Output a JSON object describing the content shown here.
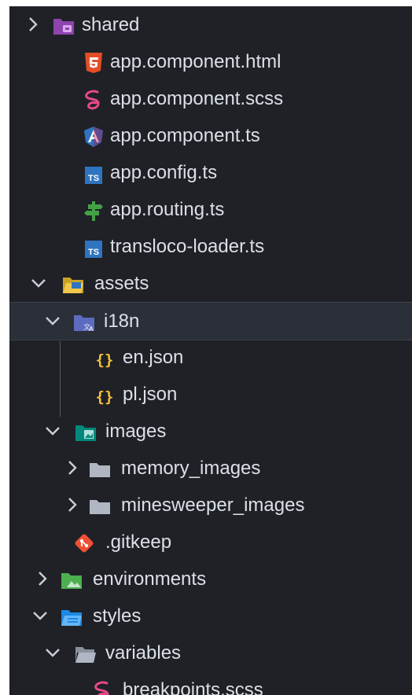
{
  "explorer": {
    "items": [
      {
        "label": "shared",
        "icon": "folder-shared-icon",
        "state": "collapsed"
      },
      {
        "label": "app.component.html",
        "icon": "html-file-icon"
      },
      {
        "label": "app.component.scss",
        "icon": "sass-file-icon"
      },
      {
        "label": "app.component.ts",
        "icon": "angular-component-icon"
      },
      {
        "label": "app.config.ts",
        "icon": "typescript-file-icon"
      },
      {
        "label": "app.routing.ts",
        "icon": "routing-file-icon"
      },
      {
        "label": "transloco-loader.ts",
        "icon": "typescript-file-icon"
      },
      {
        "label": "assets",
        "icon": "folder-assets-icon",
        "state": "expanded"
      },
      {
        "label": "i18n",
        "icon": "folder-i18n-icon",
        "state": "expanded",
        "selected": true
      },
      {
        "label": "en.json",
        "icon": "json-file-icon"
      },
      {
        "label": "pl.json",
        "icon": "json-file-icon"
      },
      {
        "label": "images",
        "icon": "folder-images-icon",
        "state": "expanded"
      },
      {
        "label": "memory_images",
        "icon": "folder-icon",
        "state": "collapsed"
      },
      {
        "label": "minesweeper_images",
        "icon": "folder-icon",
        "state": "collapsed"
      },
      {
        "label": ".gitkeep",
        "icon": "git-file-icon"
      },
      {
        "label": "environments",
        "icon": "folder-environment-icon",
        "state": "collapsed"
      },
      {
        "label": "styles",
        "icon": "folder-css-icon",
        "state": "expanded"
      },
      {
        "label": "variables",
        "icon": "folder-open-icon",
        "state": "expanded"
      },
      {
        "label": "breakpoints.scss",
        "icon": "sass-file-icon"
      }
    ]
  },
  "colors": {
    "background": "#1f2126",
    "text": "#dbe0e8",
    "selected_row": "#2b3038",
    "html_orange": "#e44d26",
    "sass_pink": "#e8488a",
    "typescript_blue": "#2f74c0",
    "json_yellow": "#f5c13b",
    "routing_green": "#43a047",
    "git_orange": "#f05033"
  }
}
